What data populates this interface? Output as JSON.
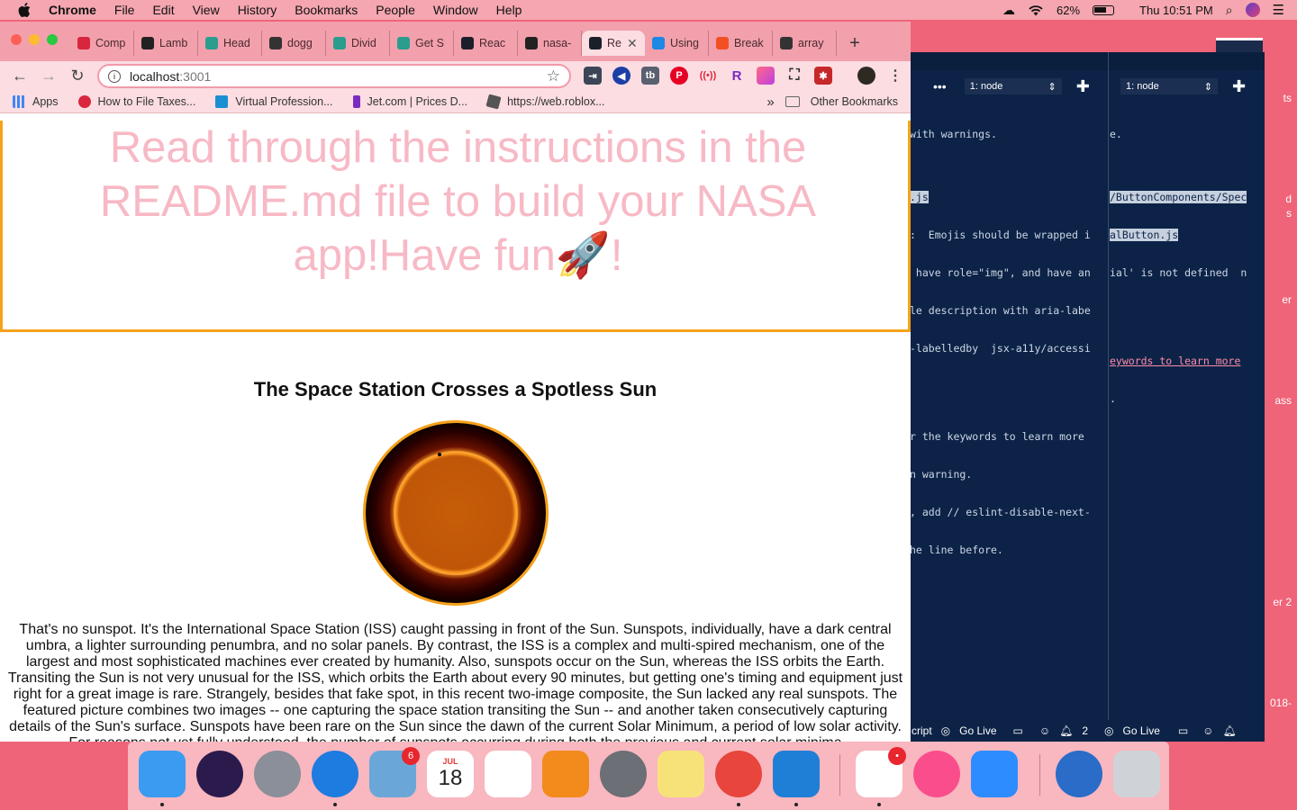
{
  "menubar": {
    "app_name": "Chrome",
    "items": [
      "File",
      "Edit",
      "View",
      "History",
      "Bookmarks",
      "People",
      "Window",
      "Help"
    ],
    "battery": "62%",
    "clock": "Thu 10:51 PM"
  },
  "browser": {
    "tabs": [
      {
        "label": "Comp",
        "icon": "angular-icon",
        "color": "#d7263d"
      },
      {
        "label": "Lamb",
        "icon": "github-icon",
        "color": "#222222"
      },
      {
        "label": "Head",
        "icon": "react-icon",
        "color": "#2a9d8f"
      },
      {
        "label": "dogg",
        "icon": "codesandbox-icon",
        "color": "#333333"
      },
      {
        "label": "Divid",
        "icon": "react-icon",
        "color": "#2a9d8f"
      },
      {
        "label": "Get S",
        "icon": "react-icon",
        "color": "#2a9d8f"
      },
      {
        "label": "Reac",
        "icon": "react-icon",
        "color": "#1b1f2a"
      },
      {
        "label": "nasa-",
        "icon": "github-icon",
        "color": "#222222"
      },
      {
        "label": "Re",
        "icon": "react-icon",
        "color": "#1b1f2a",
        "active": true
      },
      {
        "label": "Using",
        "icon": "cloud-icon",
        "color": "#1e88e5"
      },
      {
        "label": "Break",
        "icon": "microsoft-icon",
        "color": "#f25022"
      },
      {
        "label": "array",
        "icon": "codesandbox-icon",
        "color": "#333333"
      }
    ],
    "url_host": "localhost",
    "url_port": ":3001",
    "bookmarks": [
      {
        "label": "Apps",
        "color": "#4285f4"
      },
      {
        "label": "How to File Taxes...",
        "color": "#d7263d"
      },
      {
        "label": "Virtual Profession...",
        "color": "#1a8fd1"
      },
      {
        "label": "Jet.com | Prices D...",
        "color": "#7b2cbf"
      },
      {
        "label": "https://web.roblox...",
        "color": "#555555"
      }
    ],
    "bookmarks_overflow": "»",
    "other_bookmarks": "Other Bookmarks"
  },
  "page": {
    "banner_text": "Read through the instructions in the README.md file to build your NASA app!Have fun🚀!",
    "apod_title": "The Space Station Crosses a Spotless Sun",
    "apod_description": "That's no sunspot. It's the International Space Station (ISS) caught passing in front of the Sun. Sunspots, individually, have a dark central umbra, a lighter surrounding penumbra, and no solar panels. By contrast, the ISS is a complex and multi-spired mechanism, one of the largest and most sophisticated machines ever created by humanity. Also, sunspots occur on the Sun, whereas the ISS orbits the Earth. Transiting the Sun is not very unusual for the ISS, which orbits the Earth about every 90 minutes, but getting one's timing and equipment just right for a great image is rare. Strangely, besides that fake spot, in this recent two-image composite, the Sun lacked any real sunspots. The featured picture combines two images -- one capturing the space station transiting the Sun -- and another taken consecutively capturing details of the Sun's surface. Sunspots have been rare on the Sun since the dawn of the current Solar Minimum, a period of low solar activity. For reasons not yet fully understood, the number of sunspots occurring during both the previous and current solar minima"
  },
  "terminal": {
    "dropdown_left": "1: node",
    "dropdown_right": "1: node",
    "left_pane": [
      "with warnings.",
      "",
      ".js",
      ":  Emojis should be wrapped i",
      " have role=\"img\", and have an",
      "le description with aria-labe",
      "-labelledby  jsx-a11y/accessi",
      "",
      "",
      "r the keywords to learn more",
      "n warning.",
      ", add // eslint-disable-next-",
      "he line before."
    ],
    "right_pane": [
      "e.",
      "",
      "/ButtonComponents/Spec",
      "alButton.js",
      "ial' is not defined  n",
      "",
      "",
      "eywords to learn more",
      "."
    ],
    "status_left": [
      "cript",
      "Go Live",
      "2"
    ],
    "status_right": [
      "Go Live"
    ]
  },
  "desktop_labels": [
    "ts",
    "d",
    "s",
    "er",
    "ass",
    "er 2",
    "018-"
  ],
  "dock": {
    "apps": [
      {
        "name": "finder-icon",
        "color": "#3a9bf0"
      },
      {
        "name": "siri-icon",
        "color": "#2b1b4d"
      },
      {
        "name": "launchpad-icon",
        "color": "#8a8f99"
      },
      {
        "name": "safari-icon",
        "color": "#1e7be0"
      },
      {
        "name": "mail-icon",
        "color": "#6aa7d8",
        "badge": "6"
      },
      {
        "name": "calendar-icon",
        "color": "#ffffff",
        "month": "JUL",
        "day": "18"
      },
      {
        "name": "reminders-icon",
        "color": "#ffffff"
      },
      {
        "name": "books-icon",
        "color": "#f28b1c"
      },
      {
        "name": "system-preferences-icon",
        "color": "#6c6f75"
      },
      {
        "name": "notes-icon",
        "color": "#f7e27a"
      },
      {
        "name": "chrome-icon",
        "color": "#e8453c"
      },
      {
        "name": "vscode-icon",
        "color": "#1f7fd6"
      },
      {
        "name": "slack-icon",
        "color": "#ffffff",
        "badge": "•"
      },
      {
        "name": "itunes-icon",
        "color": "#fa4e8c"
      },
      {
        "name": "zoom-icon",
        "color": "#2d8cff"
      },
      {
        "name": "network-icon",
        "color": "#2a6cc8"
      },
      {
        "name": "trash-icon",
        "color": "#cfd3d8"
      }
    ]
  }
}
